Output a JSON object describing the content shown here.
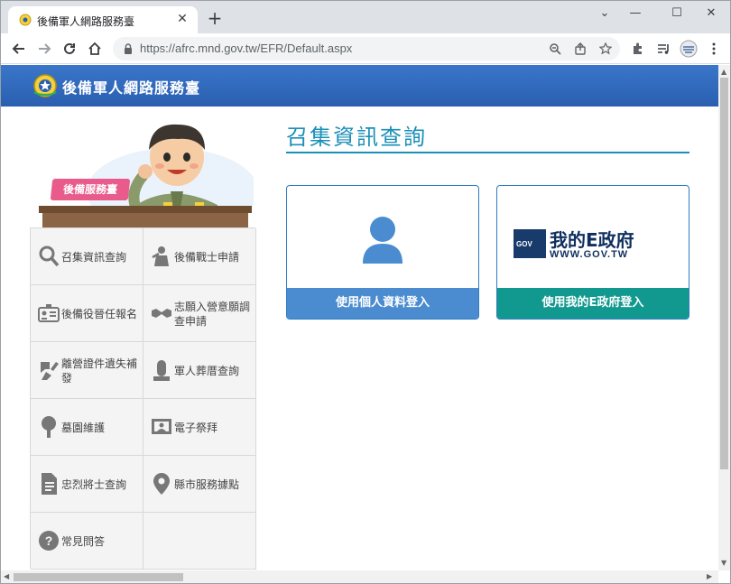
{
  "browser": {
    "tab_title": "後備軍人網路服務臺",
    "tab_close": "✕",
    "new_tab": "+",
    "url": "https://afrc.mnd.gov.tw/EFR/Default.aspx",
    "window_controls": {
      "menu": "⌄",
      "minimize": "—",
      "maximize": "☐",
      "close": "✕"
    }
  },
  "site": {
    "title": "後備軍人網路服務臺",
    "mascot_label": "後備服務臺",
    "header_color": "#2f6bbd"
  },
  "menu": {
    "items": [
      {
        "label": "召集資訊查詢",
        "icon": "search-icon"
      },
      {
        "label": "後備戰士申請",
        "icon": "soldier-icon"
      },
      {
        "label": "後備役晉任報名",
        "icon": "id-card-icon"
      },
      {
        "label": "志願入營意願調查申請",
        "icon": "handshake-icon"
      },
      {
        "label": "離營證件遺失補發",
        "icon": "lost-document-icon"
      },
      {
        "label": "軍人葬厝查詢",
        "icon": "tomb-icon"
      },
      {
        "label": "墓園維護",
        "icon": "tree-icon"
      },
      {
        "label": "電子祭拜",
        "icon": "portrait-icon"
      },
      {
        "label": "忠烈將士查詢",
        "icon": "document-icon"
      },
      {
        "label": "縣市服務據點",
        "icon": "location-pin-icon"
      },
      {
        "label": "常見問答",
        "icon": "question-icon"
      },
      {
        "label": "",
        "icon": ""
      }
    ]
  },
  "main": {
    "heading": "召集資訊查詢",
    "cards": [
      {
        "button": "使用個人資料登入",
        "icon": "user-icon",
        "color": "#4a8ccf"
      },
      {
        "button": "使用我的E政府登入",
        "icon": "my-egov-logo",
        "logo_main": "我的E政府",
        "logo_sub": "WWW.GOV.TW",
        "logo_badge": "GOV",
        "color": "#12998f"
      }
    ]
  }
}
